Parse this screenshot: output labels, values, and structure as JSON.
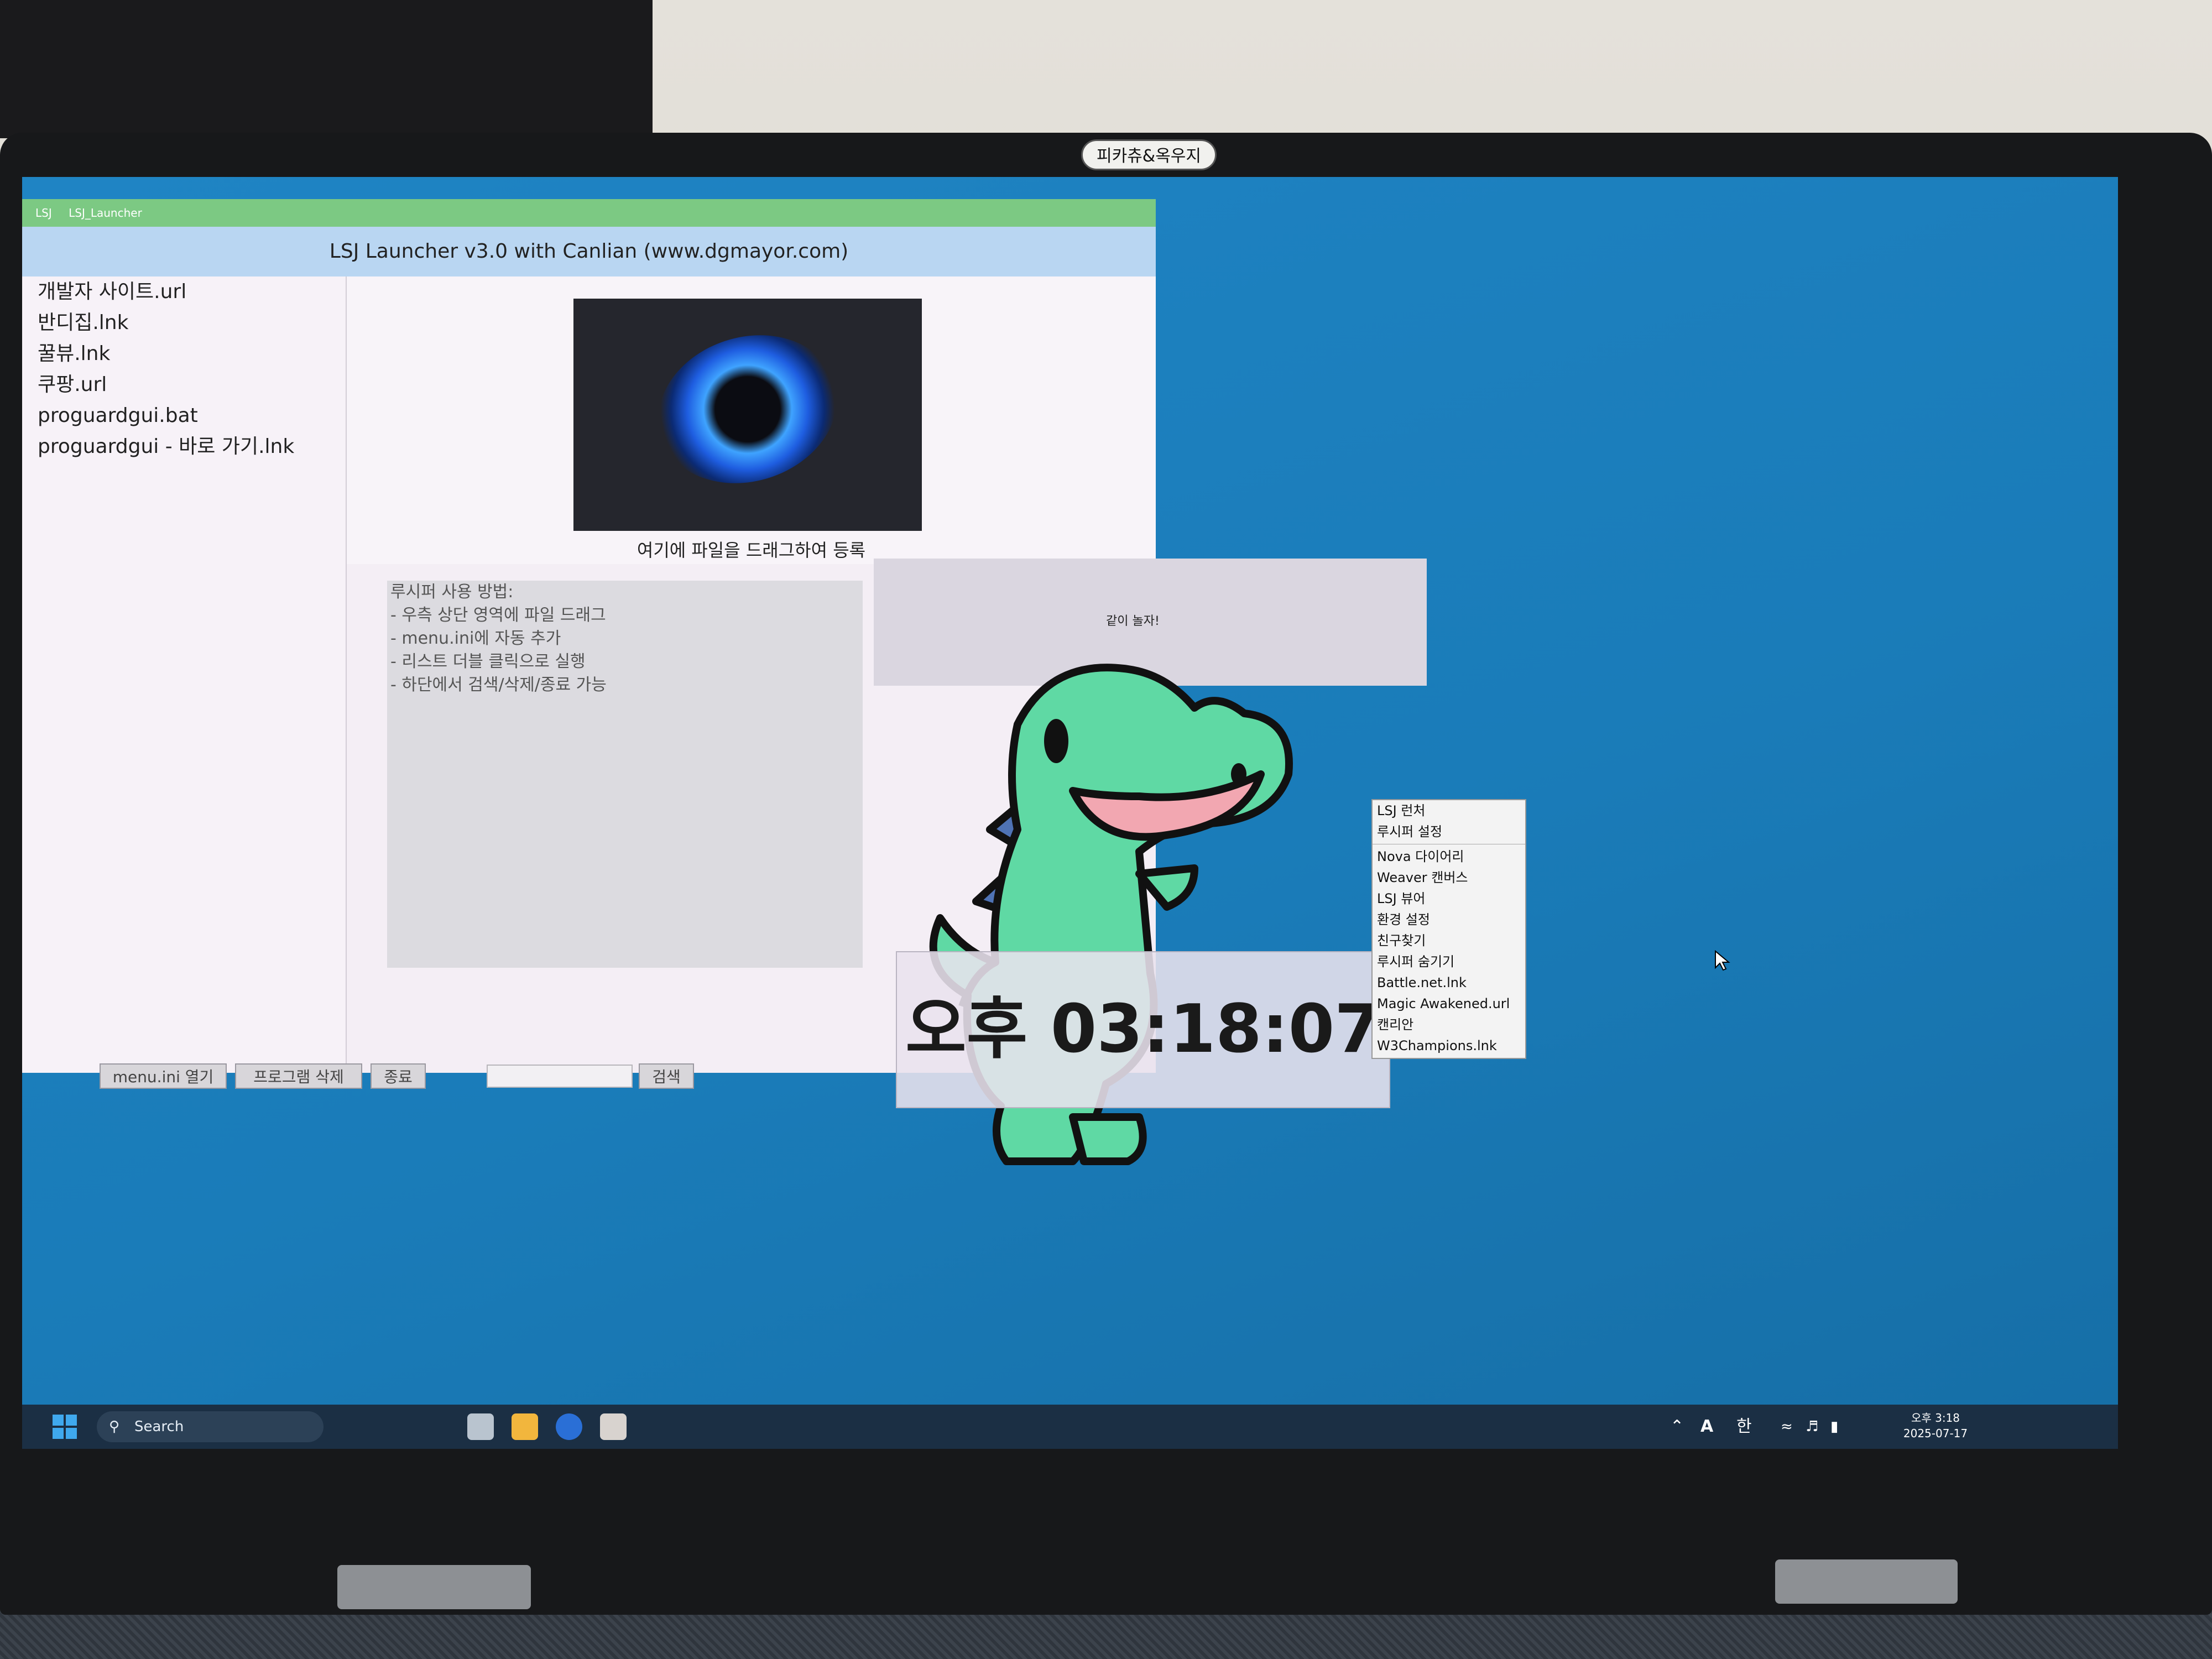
{
  "bezel_label": "피카츄&옥우지",
  "window": {
    "title_short": "LSJ",
    "title": "LSJ_Launcher",
    "header": "LSJ Launcher v3.0 with Canlian (www.dgmayor.com)"
  },
  "file_list": [
    "개발자 사이트.url",
    "반디집.lnk",
    "꿀뷰.lnk",
    "쿠팡.url",
    "proguardgui.bat",
    "proguardgui - 바로 가기.lnk"
  ],
  "dropzone_label": "여기에 파일을 드래그하여 등록",
  "usage": {
    "title": "루시퍼 사용 방법:",
    "lines": [
      "- 우측 상단 영역에 파일 드래그",
      "- menu.ini에 자동 추가",
      "- 리스트 더블 클릭으로 실행",
      "- 하단에서 검색/삭제/종료 가능"
    ]
  },
  "shout_text": "같이 놀자!",
  "buttons": {
    "open_menu": "menu.ini 열기",
    "delete_program": "프로그램 삭제",
    "exit": "종료",
    "search": "검색"
  },
  "search_value": "",
  "clock_text": "오후 03:18:07",
  "context_menu": {
    "group1": [
      "LSJ 런처",
      "루시퍼 설정"
    ],
    "group2": [
      "Nova 다이어리",
      "Weaver 캔버스",
      "LSJ 뷰어",
      "환경 설정",
      "친구찾기",
      "루시퍼 숨기기",
      "Battle.net.lnk",
      "Magic Awakened.url",
      "캔리안",
      "W3Champions.lnk"
    ]
  },
  "taskbar": {
    "search_label": "Search",
    "tray_ime_a": "A",
    "tray_ime_lang": "한",
    "time": "오후 3:18",
    "date": "2025-07-17"
  },
  "colors": {
    "desktop": "#1f84c4",
    "titlebar": "#7cc983",
    "banner": "#b9d6f2",
    "dino_body": "#5fd9a4",
    "dino_mouth": "#f2a7b1",
    "dino_spikes": "#4f73b5"
  },
  "icons": [
    "windows-start-icon",
    "search-icon",
    "task-view-icon",
    "file-explorer-icon",
    "firefox-icon",
    "app-icon",
    "chevron-up-icon",
    "wifi-icon",
    "volume-icon",
    "battery-icon",
    "mouse-cursor-icon"
  ]
}
